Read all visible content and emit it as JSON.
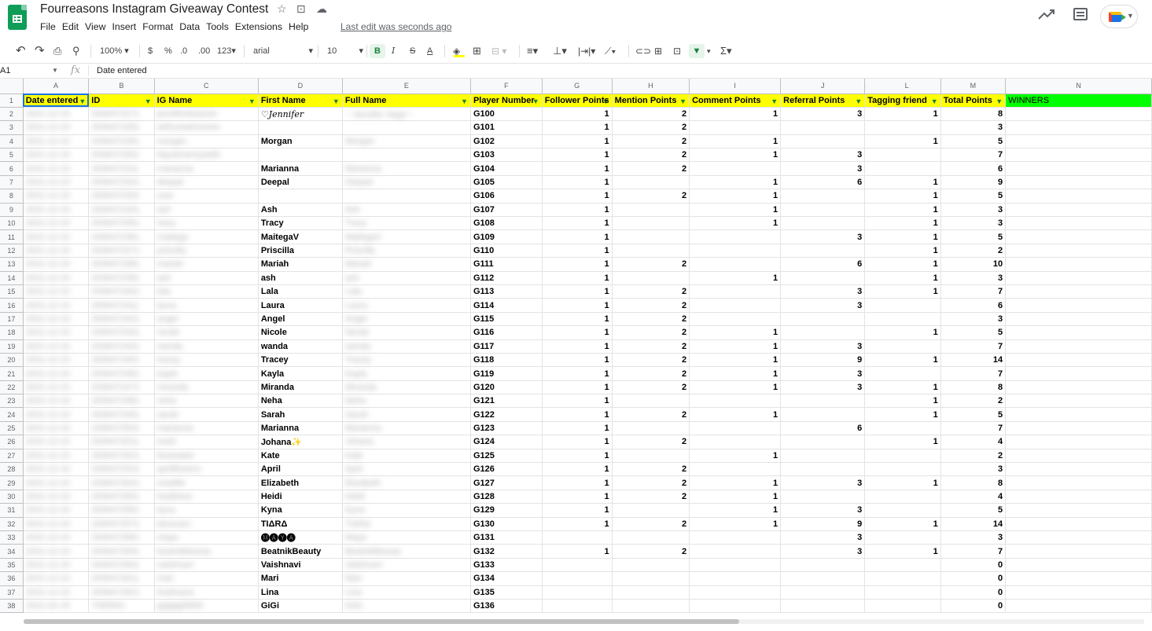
{
  "doc": {
    "title": "Fourreasons Instagram Giveaway Contest",
    "last_edit": "Last edit was seconds ago"
  },
  "header_icons": {
    "star": "☆",
    "move": "⊡",
    "cloud": "☁"
  },
  "menu": [
    "File",
    "Edit",
    "View",
    "Insert",
    "Format",
    "Data",
    "Tools",
    "Extensions",
    "Help"
  ],
  "toolbar": {
    "zoom": "100%",
    "currency": "$",
    "percent": "%",
    "dec_less": ".0",
    "dec_more": ".00",
    "format_more": "123",
    "font": "arial",
    "font_size": "10",
    "bold": "B",
    "italic": "I",
    "strike": "S",
    "text_color": "A"
  },
  "formula_bar": {
    "name_box": "A1",
    "fx": "fx",
    "value": "Date entered"
  },
  "columns": [
    "A",
    "B",
    "C",
    "D",
    "E",
    "F",
    "G",
    "H",
    "I",
    "J",
    "L",
    "M",
    "N"
  ],
  "hidden_col_marker": "◂ ▸",
  "headers": [
    "Date entered",
    "ID",
    "IG Name",
    "First Name",
    "Full Name",
    "Player Number",
    "Follower Points",
    "Mention Points",
    "Comment Points",
    "Referral Points",
    "Tagging friend",
    "Total Points",
    "WINNERS"
  ],
  "rows": [
    {
      "n": "2",
      "date": "2021-12-10",
      "id": "2006472271",
      "ig": "jenniferdreamer",
      "fn": "♡Jennifer",
      "full": "♡Jennifer Vega♡",
      "pn": "G100",
      "fp": "1",
      "mp": "2",
      "cp": "1",
      "rp": "3",
      "tf": "1",
      "tp": "8"
    },
    {
      "n": "3",
      "date": "2021-12-10",
      "id": "2006472281",
      "ig": "withuswelcomes",
      "fn": "",
      "full": "",
      "pn": "G101",
      "fp": "1",
      "mp": "2",
      "cp": "",
      "rp": "",
      "tf": "",
      "tp": "3"
    },
    {
      "n": "4",
      "date": "2021-12-10",
      "id": "2006472291",
      "ig": "morgan",
      "fn": "Morgan",
      "full": "Morgan",
      "pn": "G102",
      "fp": "1",
      "mp": "2",
      "cp": "1",
      "rp": "",
      "tf": "1",
      "tp": "5"
    },
    {
      "n": "5",
      "date": "2021-12-10",
      "id": "2006472301",
      "ig": "itsjustmemyselfx",
      "fn": "",
      "full": "",
      "pn": "G103",
      "fp": "1",
      "mp": "2",
      "cp": "1",
      "rp": "3",
      "tf": "",
      "tp": "7"
    },
    {
      "n": "6",
      "date": "2021-12-10",
      "id": "2006472311",
      "ig": "marianna",
      "fn": "Marianna",
      "full": "Marianna",
      "pn": "G104",
      "fp": "1",
      "mp": "2",
      "cp": "",
      "rp": "3",
      "tf": "",
      "tp": "6"
    },
    {
      "n": "7",
      "date": "2021-12-10",
      "id": "2006472321",
      "ig": "deepal",
      "fn": "Deepal",
      "full": "Deepal",
      "pn": "G105",
      "fp": "1",
      "mp": "",
      "cp": "1",
      "rp": "6",
      "tf": "1",
      "tp": "9"
    },
    {
      "n": "8",
      "date": "2021-12-10",
      "id": "2006472331",
      "ig": "user",
      "fn": "",
      "full": "",
      "pn": "G106",
      "fp": "1",
      "mp": "2",
      "cp": "1",
      "rp": "",
      "tf": "1",
      "tp": "5"
    },
    {
      "n": "9",
      "date": "2021-12-10",
      "id": "2006472341",
      "ig": "ash",
      "fn": "Ash",
      "full": "Ash",
      "pn": "G107",
      "fp": "1",
      "mp": "",
      "cp": "1",
      "rp": "",
      "tf": "1",
      "tp": "3"
    },
    {
      "n": "10",
      "date": "2021-12-10",
      "id": "2006472351",
      "ig": "tracy",
      "fn": "Tracy",
      "full": "Tracy",
      "pn": "G108",
      "fp": "1",
      "mp": "",
      "cp": "1",
      "rp": "",
      "tf": "1",
      "tp": "3"
    },
    {
      "n": "11",
      "date": "2021-12-10",
      "id": "2006472361",
      "ig": "maitega",
      "fn": "MaitegaV",
      "full": "MaitegaV",
      "pn": "G109",
      "fp": "1",
      "mp": "",
      "cp": "",
      "rp": "3",
      "tf": "1",
      "tp": "5"
    },
    {
      "n": "12",
      "date": "2021-12-10",
      "id": "2006472371",
      "ig": "priscilla",
      "fn": "Priscilla",
      "full": "Priscilla",
      "pn": "G110",
      "fp": "1",
      "mp": "",
      "cp": "",
      "rp": "",
      "tf": "1",
      "tp": "2"
    },
    {
      "n": "13",
      "date": "2021-12-10",
      "id": "2006472381",
      "ig": "mariah",
      "fn": "Mariah",
      "full": "Mariah",
      "pn": "G111",
      "fp": "1",
      "mp": "2",
      "cp": "",
      "rp": "6",
      "tf": "1",
      "tp": "10"
    },
    {
      "n": "14",
      "date": "2021-12-10",
      "id": "2006472391",
      "ig": "ash",
      "fn": "ash",
      "full": "ash",
      "pn": "G112",
      "fp": "1",
      "mp": "",
      "cp": "1",
      "rp": "",
      "tf": "1",
      "tp": "3"
    },
    {
      "n": "15",
      "date": "2021-12-10",
      "id": "2006472401",
      "ig": "lala",
      "fn": "Lala",
      "full": "Lala",
      "pn": "G113",
      "fp": "1",
      "mp": "2",
      "cp": "",
      "rp": "3",
      "tf": "1",
      "tp": "7"
    },
    {
      "n": "16",
      "date": "2021-12-10",
      "id": "2006472411",
      "ig": "laura",
      "fn": "Laura",
      "full": "Laura",
      "pn": "G114",
      "fp": "1",
      "mp": "2",
      "cp": "",
      "rp": "3",
      "tf": "",
      "tp": "6"
    },
    {
      "n": "17",
      "date": "2021-12-10",
      "id": "2006472421",
      "ig": "angel",
      "fn": "Angel",
      "full": "Angel",
      "pn": "G115",
      "fp": "1",
      "mp": "2",
      "cp": "",
      "rp": "",
      "tf": "",
      "tp": "3"
    },
    {
      "n": "18",
      "date": "2021-12-10",
      "id": "2006472431",
      "ig": "nicole",
      "fn": "Nicole",
      "full": "Nicole",
      "pn": "G116",
      "fp": "1",
      "mp": "2",
      "cp": "1",
      "rp": "",
      "tf": "1",
      "tp": "5"
    },
    {
      "n": "19",
      "date": "2021-12-10",
      "id": "2006472441",
      "ig": "wanda",
      "fn": "wanda",
      "full": "wanda",
      "pn": "G117",
      "fp": "1",
      "mp": "2",
      "cp": "1",
      "rp": "3",
      "tf": "",
      "tp": "7"
    },
    {
      "n": "20",
      "date": "2021-12-10",
      "id": "2006472451",
      "ig": "tracey",
      "fn": "Tracey",
      "full": "Tracey",
      "pn": "G118",
      "fp": "1",
      "mp": "2",
      "cp": "1",
      "rp": "9",
      "tf": "1",
      "tp": "14"
    },
    {
      "n": "21",
      "date": "2021-12-10",
      "id": "2006472461",
      "ig": "kayla",
      "fn": "Kayla",
      "full": "Kayla",
      "pn": "G119",
      "fp": "1",
      "mp": "2",
      "cp": "1",
      "rp": "3",
      "tf": "",
      "tp": "7"
    },
    {
      "n": "22",
      "date": "2021-12-10",
      "id": "2006472471",
      "ig": "miranda",
      "fn": "Miranda",
      "full": "Miranda",
      "pn": "G120",
      "fp": "1",
      "mp": "2",
      "cp": "1",
      "rp": "3",
      "tf": "1",
      "tp": "8"
    },
    {
      "n": "23",
      "date": "2021-12-10",
      "id": "2006472481",
      "ig": "neha",
      "fn": "Neha",
      "full": "Neha",
      "pn": "G121",
      "fp": "1",
      "mp": "",
      "cp": "",
      "rp": "",
      "tf": "1",
      "tp": "2"
    },
    {
      "n": "24",
      "date": "2021-12-10",
      "id": "2006472491",
      "ig": "sarah",
      "fn": "Sarah",
      "full": "Sarah",
      "pn": "G122",
      "fp": "1",
      "mp": "2",
      "cp": "1",
      "rp": "",
      "tf": "1",
      "tp": "5"
    },
    {
      "n": "25",
      "date": "2021-12-10",
      "id": "2006472501",
      "ig": "marianna",
      "fn": "Marianna",
      "full": "Marianna",
      "pn": "G123",
      "fp": "1",
      "mp": "",
      "cp": "",
      "rp": "6",
      "tf": "",
      "tp": "7"
    },
    {
      "n": "26",
      "date": "2021-12-10",
      "id": "2006472511",
      "ig": "trash",
      "fn": "Johana",
      "fn_suffix": "✨",
      "full": "Johana",
      "pn": "G124",
      "fp": "1",
      "mp": "2",
      "cp": "",
      "rp": "",
      "tf": "1",
      "tp": "4"
    },
    {
      "n": "27",
      "date": "2021-12-10",
      "id": "2006472521",
      "ig": "bluewater",
      "fn": "Kate",
      "full": "Kate",
      "pn": "G125",
      "fp": "1",
      "mp": "",
      "cp": "1",
      "rp": "",
      "tf": "",
      "tp": "2"
    },
    {
      "n": "28",
      "date": "2021-12-10",
      "id": "2006472531",
      "ig": "aprilflowers",
      "fn": "April",
      "full": "April",
      "pn": "G126",
      "fp": "1",
      "mp": "2",
      "cp": "",
      "rp": "",
      "tf": "",
      "tp": "3"
    },
    {
      "n": "29",
      "date": "2021-12-10",
      "id": "2006472541",
      "ig": "mealife",
      "fn": "Elizabeth",
      "full": "Elizabeth",
      "pn": "G127",
      "fp": "1",
      "mp": "2",
      "cp": "1",
      "rp": "3",
      "tf": "1",
      "tp": "8"
    },
    {
      "n": "30",
      "date": "2021-12-10",
      "id": "2006472551",
      "ig": "heidihere",
      "fn": "Heidi",
      "full": "Heidi",
      "pn": "G128",
      "fp": "1",
      "mp": "2",
      "cp": "1",
      "rp": "",
      "tf": "",
      "tp": "4"
    },
    {
      "n": "31",
      "date": "2021-12-10",
      "id": "2006472561",
      "ig": "kyna",
      "fn": "Kyna",
      "full": "Kyna",
      "pn": "G129",
      "fp": "1",
      "mp": "",
      "cp": "1",
      "rp": "3",
      "tf": "",
      "tp": "5"
    },
    {
      "n": "32",
      "date": "2021-12-10",
      "id": "2006472571",
      "ig": "tiaracaro",
      "fn": "TIΔRΔ",
      "full": "TIΔRΔ",
      "pn": "G130",
      "fp": "1",
      "mp": "2",
      "cp": "1",
      "rp": "9",
      "tf": "1",
      "tp": "14"
    },
    {
      "n": "33",
      "date": "2021-12-10",
      "id": "2006472581",
      "ig": "maya",
      "fn": "🅜🅐🅨🅐",
      "full": "Maya",
      "pn": "G131",
      "fp": "",
      "mp": "",
      "cp": "",
      "rp": "3",
      "tf": "",
      "tp": "3"
    },
    {
      "n": "34",
      "date": "2021-12-10",
      "id": "2006472591",
      "ig": "beatnikbeauty",
      "fn": "BeatnikBeauty",
      "full": "BeatnikBeauty",
      "pn": "G132",
      "fp": "1",
      "mp": "2",
      "cp": "",
      "rp": "3",
      "tf": "1",
      "tp": "7"
    },
    {
      "n": "35",
      "date": "2021-12-10",
      "id": "2006472601",
      "ig": "vaishnavi",
      "fn": "Vaishnavi",
      "full": "Vaishnavi",
      "pn": "G133",
      "fp": "",
      "mp": "",
      "cp": "",
      "rp": "",
      "tf": "",
      "tp": "0"
    },
    {
      "n": "36",
      "date": "2021-12-10",
      "id": "2006472611",
      "ig": "mari",
      "fn": "Mari",
      "full": "Mari",
      "pn": "G134",
      "fp": "",
      "mp": "",
      "cp": "",
      "rp": "",
      "tf": "",
      "tp": "0"
    },
    {
      "n": "37",
      "date": "2021-12-10",
      "id": "2006472621",
      "ig": "linalinana",
      "fn": "Lina",
      "full": "Lina",
      "pn": "G135",
      "fp": "",
      "mp": "",
      "cp": "",
      "rp": "",
      "tf": "",
      "tp": "0"
    },
    {
      "n": "38",
      "date": "2021-02-15",
      "id": "7065941",
      "ig": "gigigigi5665",
      "fn": "GiGi",
      "full": "GiGi",
      "pn": "G136",
      "fp": "",
      "mp": "",
      "cp": "",
      "rp": "",
      "tf": "",
      "tp": "0"
    }
  ],
  "colors": {
    "header_fill": "#ffff00",
    "winners_fill": "#00ff00",
    "accent_green": "#188038",
    "selection_blue": "#1a73e8"
  }
}
